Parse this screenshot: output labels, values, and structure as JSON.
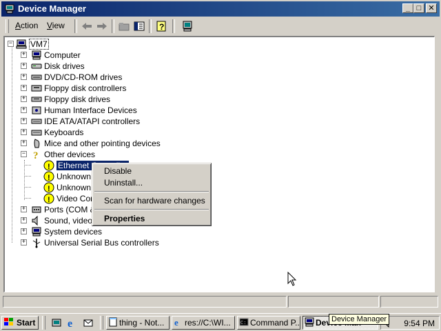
{
  "window": {
    "title": "Device Manager",
    "controls": {
      "minimize": "_",
      "maximize": "□",
      "close": "✕"
    }
  },
  "menu": {
    "action": "Action",
    "view": "View"
  },
  "tree": {
    "root": "VM7",
    "categories": [
      "Computer",
      "Disk drives",
      "DVD/CD-ROM drives",
      "Floppy disk controllers",
      "Floppy disk drives",
      "Human Interface Devices",
      "IDE ATA/ATAPI controllers",
      "Keyboards",
      "Mice and other pointing devices",
      "Other devices"
    ],
    "other_devices_children": [
      "Ethernet Controller",
      "Unknown",
      "Unknown",
      "Video Con"
    ],
    "categories_after": [
      "Ports (COM &",
      "Sound, video",
      "System devices",
      "Universal Serial Bus controllers"
    ]
  },
  "context_menu": {
    "disable": "Disable",
    "uninstall": "Uninstall...",
    "scan": "Scan for hardware changes",
    "properties": "Properties"
  },
  "taskbar": {
    "start": "Start",
    "buttons": [
      "thing - Not...",
      "res://C:\\WI...",
      "Command P...",
      "Device Man"
    ],
    "clock": "9:54 PM"
  },
  "tooltip": "Device Manager"
}
